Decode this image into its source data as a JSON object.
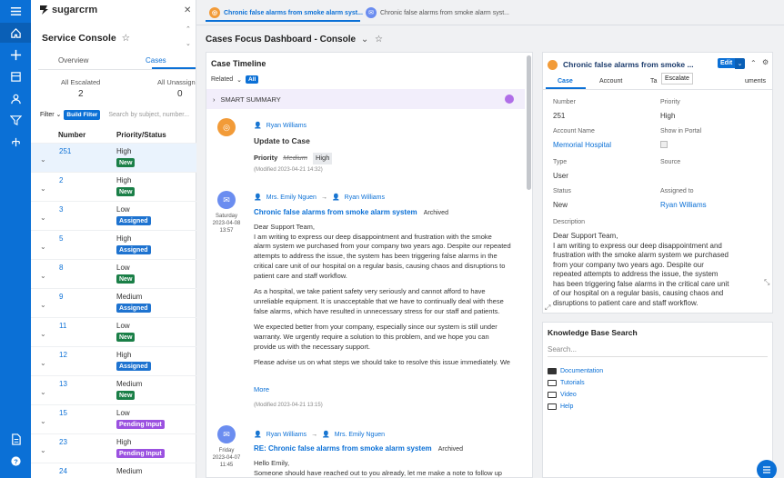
{
  "brand": {
    "name": "sugarcrm"
  },
  "console": {
    "title": "Service Console",
    "tabs": [
      "Overview",
      "Cases"
    ],
    "stats": [
      {
        "label": "All Escalated",
        "value": "2"
      },
      {
        "label": "All Unassign",
        "value": "0"
      }
    ],
    "filter_label": "Filter",
    "build_filter": "Build Filter",
    "search_placeholder": "Search by subject, number...",
    "columns": [
      "Number",
      "Priority/Status"
    ],
    "rows": [
      {
        "number": "251",
        "priority": "High",
        "status": "New"
      },
      {
        "number": "2",
        "priority": "High",
        "status": "New"
      },
      {
        "number": "3",
        "priority": "Low",
        "status": "Assigned"
      },
      {
        "number": "5",
        "priority": "High",
        "status": "Assigned"
      },
      {
        "number": "8",
        "priority": "Low",
        "status": "New"
      },
      {
        "number": "9",
        "priority": "Medium",
        "status": "Assigned"
      },
      {
        "number": "11",
        "priority": "Low",
        "status": "New"
      },
      {
        "number": "12",
        "priority": "High",
        "status": "Assigned"
      },
      {
        "number": "13",
        "priority": "Medium",
        "status": "New"
      },
      {
        "number": "15",
        "priority": "Low",
        "status": "Pending Input"
      },
      {
        "number": "23",
        "priority": "High",
        "status": "Pending Input"
      },
      {
        "number": "24",
        "priority": "Medium",
        "status": ""
      }
    ]
  },
  "tabstrip": {
    "tabs": [
      "Chronic false alarms from smoke alarm syst...",
      "Chronic false alarms from smoke alarm syst..."
    ]
  },
  "dashboard": {
    "title": "Cases Focus Dashboard - Console"
  },
  "timeline": {
    "title": "Case Timeline",
    "related": "Related",
    "all": "All",
    "smart_summary": "SMART SUMMARY",
    "entry1": {
      "author": "Ryan Williams",
      "title": "Update to Case",
      "field": "Priority",
      "old": "Medium",
      "new": "High",
      "modified": "(Modified 2023-04-21 14:32)"
    },
    "entry2": {
      "day": "Saturday",
      "date": "2023-04-08",
      "time": "13:57",
      "from": "Mrs. Emily Nguen",
      "to": "Ryan Williams",
      "subject": "Chronic false alarms from smoke alarm system",
      "tag": "Archived",
      "lines": [
        "Dear Support Team,",
        "I am writing to express our deep disappointment and frustration with the smoke",
        "alarm system we purchased from your company two years ago. Despite our repeated",
        "attempts to address the issue, the system has been triggering false alarms in the",
        "critical care unit of our hospital on a regular basis, causing chaos and disruptions to",
        "patient care and staff workflow.",
        "As a hospital, we take patient safety very seriously and cannot afford to have",
        "unreliable equipment. It is unacceptable that we have to continually deal with these",
        "false alarms, which have resulted in unnecessary stress for our staff and patients.",
        "We expected better from your company, especially since our system is still under",
        "warranty. We urgently require a solution to this problem, and we hope you can",
        "provide us with the necessary support.",
        "Please advise us on what steps we should take to resolve this issue immediately. We"
      ],
      "more": "More",
      "modified": "(Modified 2023-04-21 13:15)"
    },
    "entry3": {
      "day": "Friday",
      "date": "2023-04-07",
      "time": "11:45",
      "from": "Ryan Williams",
      "to": "Mrs. Emily Nguen",
      "subject": "RE: Chronic false alarms from smoke alarm system",
      "tag": "Archived",
      "lines": [
        "Hello Emily,",
        "Someone should have reached out to you already, let me make a note to follow up"
      ]
    }
  },
  "record": {
    "title": "Chronic false alarms from smoke ...",
    "edit": "Edit",
    "tabs": [
      "Case",
      "Account",
      "Ta",
      "uments"
    ],
    "tooltip": "Escalate",
    "fields": {
      "number_label": "Number",
      "number": "251",
      "priority_label": "Priority",
      "priority": "High",
      "account_label": "Account Name",
      "account": "Memorial Hospital",
      "portal_label": "Show in Portal",
      "type_label": "Type",
      "type": "User",
      "source_label": "Source",
      "status_label": "Status",
      "status": "New",
      "assigned_label": "Assigned to",
      "assigned": "Ryan Williams",
      "description_label": "Description"
    },
    "description": [
      "Dear Support Team,",
      "I am writing to express our deep disappointment and",
      "frustration with the smoke alarm system we purchased",
      "from your company two years ago. Despite our",
      "repeated attempts to address the issue, the system",
      "has been triggering false alarms in the critical care unit",
      "of our hospital on a regular basis, causing chaos and",
      "disruptions to patient care and staff workflow."
    ]
  },
  "kb": {
    "title": "Knowledge Base Search",
    "placeholder": "Search...",
    "items": [
      "Documentation",
      "Tutorials",
      "Video",
      "Help"
    ]
  },
  "colors": {
    "accent": "#0b70d6",
    "new": "#1a7f47",
    "assigned": "#1e73d0",
    "pending": "#9b51e0",
    "orange": "#f29b38"
  }
}
